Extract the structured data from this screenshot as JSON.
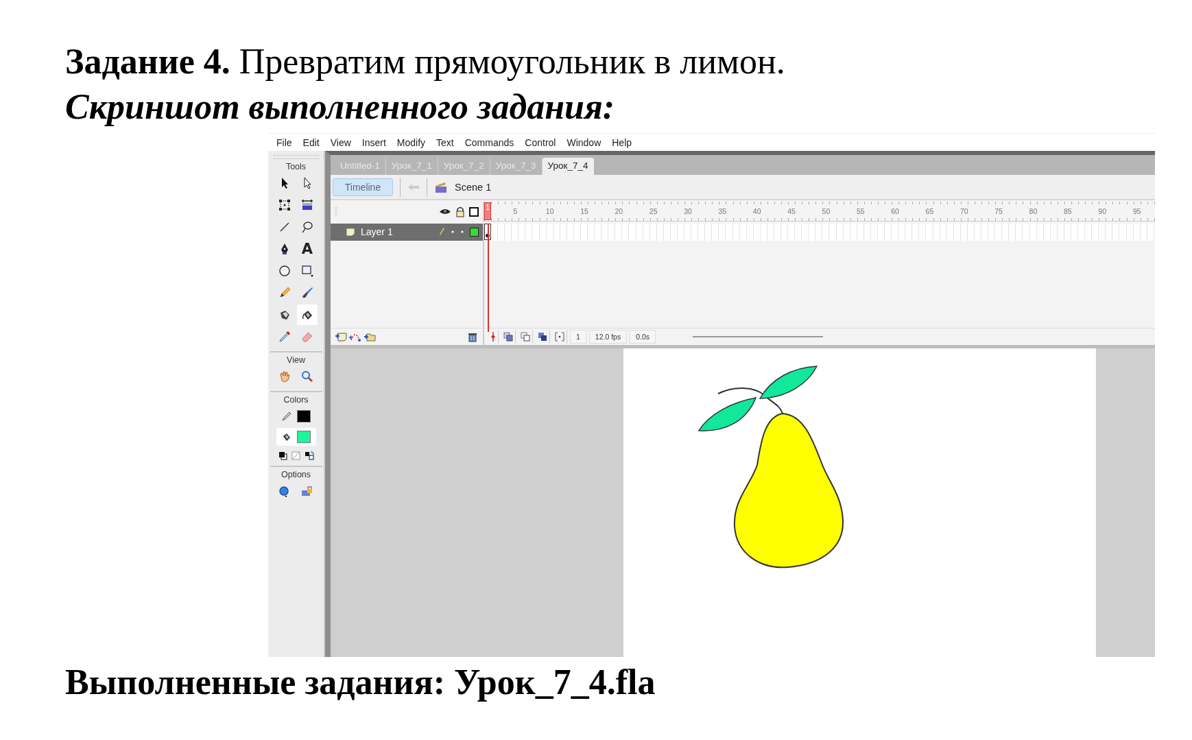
{
  "task": {
    "label": "Задание 4.",
    "text": "Превратим прямоугольник в лимон."
  },
  "subtitle": "Скриншот выполненного задания:",
  "app": {
    "menu": [
      "File",
      "Edit",
      "View",
      "Insert",
      "Modify",
      "Text",
      "Commands",
      "Control",
      "Window",
      "Help"
    ],
    "tools_panel": {
      "title": "Tools",
      "tools": [
        {
          "kind": "arrow",
          "selected": false
        },
        {
          "kind": "subselect",
          "selected": false
        },
        {
          "kind": "transform",
          "selected": false
        },
        {
          "kind": "gradient",
          "selected": false
        },
        {
          "kind": "line",
          "selected": false
        },
        {
          "kind": "lasso",
          "selected": false
        },
        {
          "kind": "pen",
          "selected": false
        },
        {
          "kind": "text",
          "glyph": "A",
          "selected": false
        },
        {
          "kind": "oval",
          "selected": false
        },
        {
          "kind": "rectangle",
          "selected": false
        },
        {
          "kind": "pencil",
          "selected": false
        },
        {
          "kind": "brush",
          "selected": false
        },
        {
          "kind": "ink",
          "selected": false
        },
        {
          "kind": "bucket",
          "selected": true
        },
        {
          "kind": "dropper",
          "selected": false
        },
        {
          "kind": "eraser",
          "selected": false
        }
      ],
      "view_title": "View",
      "colors_title": "Colors",
      "stroke": {
        "color": "#000000"
      },
      "fill": {
        "color": "#1ff59a",
        "selected": true
      },
      "options_title": "Options"
    },
    "tabs": [
      {
        "label": "Untitled-1",
        "selected": false
      },
      {
        "label": "Урок_7_1",
        "selected": false
      },
      {
        "label": "Урок_7_2",
        "selected": false
      },
      {
        "label": "Урок_7_3",
        "selected": false
      },
      {
        "label": "Урок_7_4",
        "selected": true
      }
    ],
    "timeline_button": "Timeline",
    "scene": "Scene 1",
    "playhead_frame": "1",
    "frame_numbers": [
      "5",
      "10",
      "15",
      "20",
      "25",
      "30",
      "35",
      "40",
      "45",
      "50",
      "55",
      "60",
      "65",
      "70",
      "75",
      "80",
      "85",
      "90",
      "95"
    ],
    "layers": [
      {
        "name": "Layer 1",
        "selected": true,
        "color": "#33dd33"
      }
    ],
    "status": {
      "frame": "1",
      "fps": "12.0 fps",
      "time": "0.0s"
    }
  },
  "footer": "Выполненные задания: Урок_7_4.fla"
}
